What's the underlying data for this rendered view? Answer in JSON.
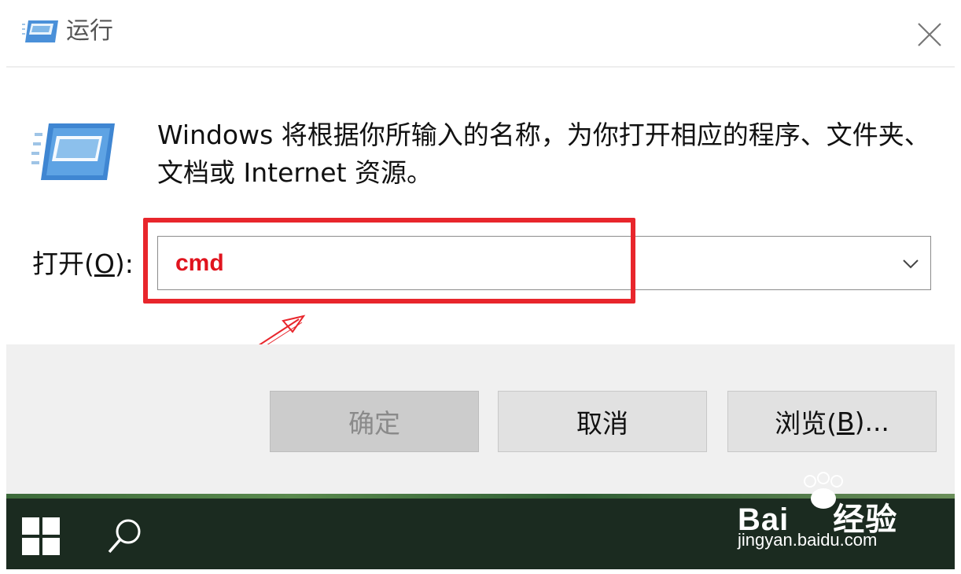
{
  "window": {
    "title": "运行",
    "close_glyph": "✕"
  },
  "description": "Windows 将根据你所输入的名称，为你打开相应的程序、文件夹、文档或 Internet 资源。",
  "open_field": {
    "label_prefix": "打开(",
    "label_hotkey": "O",
    "label_suffix": "):",
    "value": "cmd"
  },
  "buttons": {
    "ok": "确定",
    "cancel": "取消",
    "browse_prefix": "浏览(",
    "browse_hotkey": "B",
    "browse_suffix": ")..."
  },
  "watermark": {
    "brand_a": "Bai",
    "brand_b": "经验",
    "url": "jingyan.baidu.com"
  },
  "icons": {
    "title": "run-app-icon",
    "dialog": "run-app-icon",
    "close": "close-icon",
    "dropdown": "chevron-down-icon",
    "start": "windows-logo-icon",
    "search": "search-icon",
    "paw": "paw-icon"
  },
  "colors": {
    "highlight": "#e8262c",
    "command_text": "#e0141e",
    "taskbar": "#1b2b20"
  }
}
